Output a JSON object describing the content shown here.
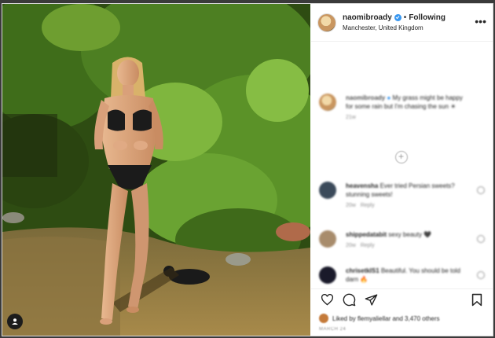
{
  "post": {
    "username": "naomibroady",
    "separator": "•",
    "follow_status": "Following",
    "location": "Manchester, United Kingdom",
    "more_icon": "more-options-icon",
    "colors": {
      "verified": "#3897f0",
      "text": "#262626",
      "meta": "#8e8e8e"
    }
  },
  "caption": {
    "username": "naomibroady",
    "text": "My grass might be happy for some rain but I'm chasing the sun ☀",
    "time": "21w"
  },
  "comments": [
    {
      "user": "heavensha",
      "text": "Ever tried Persian sweets? stunning sweets!",
      "time": "20w",
      "reply": "Reply",
      "avatar_color": "#3b4a5a"
    },
    {
      "user": "shippedatabit",
      "text": "sexy beauty 🖤",
      "time": "20w",
      "reply": "Reply",
      "avatar_color": "#a88c6c"
    },
    {
      "user": "chrisetkIS1",
      "text": "Beautiful. You should be told darn 🔥",
      "time": "",
      "reply": "",
      "avatar_color": "#1a1a2a"
    }
  ],
  "likes": {
    "text": "Liked by flemyaliellar and 3,470 others"
  },
  "date": {
    "text": "MARCH 24"
  }
}
